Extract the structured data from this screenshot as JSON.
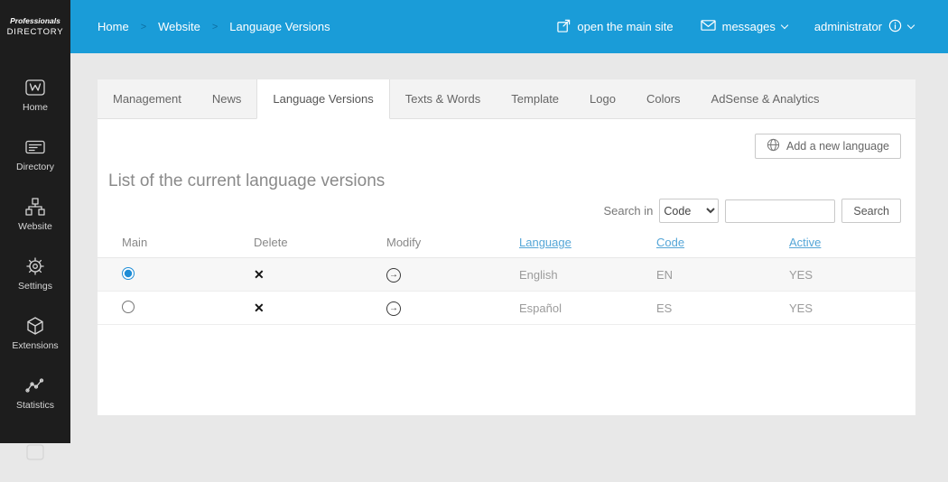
{
  "sidebar": {
    "logo_line1": "Professionals",
    "logo_line2": "DIRECTORY",
    "items": [
      {
        "label": "Home"
      },
      {
        "label": "Directory"
      },
      {
        "label": "Website"
      },
      {
        "label": "Settings"
      },
      {
        "label": "Extensions"
      },
      {
        "label": "Statistics"
      }
    ]
  },
  "topbar": {
    "breadcrumb": [
      "Home",
      "Website",
      "Language Versions"
    ],
    "separator": ">",
    "open_main_site_label": "open the main site",
    "messages_label": "messages",
    "user_label": "administrator"
  },
  "tabs": [
    {
      "label": "Management"
    },
    {
      "label": "News"
    },
    {
      "label": "Language Versions"
    },
    {
      "label": "Texts & Words"
    },
    {
      "label": "Template"
    },
    {
      "label": "Logo"
    },
    {
      "label": "Colors"
    },
    {
      "label": "AdSense & Analytics"
    }
  ],
  "active_tab": "Language Versions",
  "panel": {
    "add_language_button": "Add a new language",
    "heading": "List of the current language versions",
    "search_label": "Search in",
    "search_selected_option": "Code",
    "search_input_value": "",
    "search_button": "Search"
  },
  "table": {
    "headers": {
      "main": "Main",
      "delete": "Delete",
      "modify": "Modify",
      "language": "Language",
      "code": "Code",
      "active": "Active"
    },
    "rows": [
      {
        "main_selected": true,
        "language": "English",
        "code": "EN",
        "active": "YES"
      },
      {
        "main_selected": false,
        "language": "Español",
        "code": "ES",
        "active": "YES"
      }
    ]
  },
  "icons": {
    "delete_glyph": "✕",
    "modify_glyph": "→"
  },
  "colors": {
    "topbar_blue": "#1a9cd8",
    "sidebar_dark": "#1d1d1d",
    "link_blue": "#55a6d7",
    "content_bg": "#e8e8e8",
    "row_alt_bg": "#f7f7f7"
  }
}
